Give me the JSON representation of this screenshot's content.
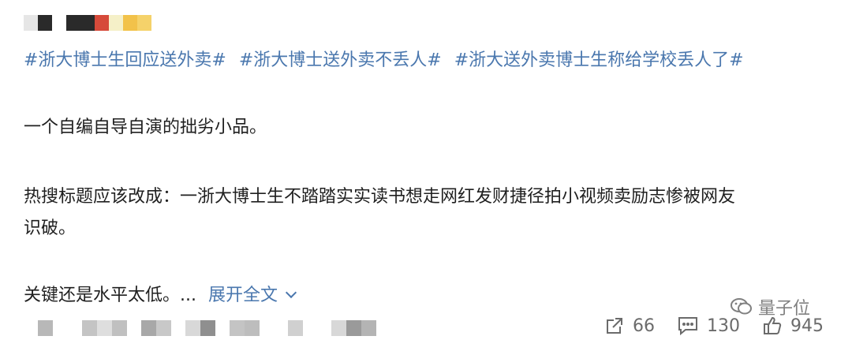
{
  "hashtags": [
    "#浙大博士生回应送外卖#",
    "#浙大博士送外卖不丢人#",
    "#浙大送外卖博士生称给学校丢人了#"
  ],
  "paragraphs": {
    "p1": "一个自编自导自演的拙劣小品。",
    "p2_line1": "热搜标题应该改成：一浙大博士生不踏踏实实读书想走网红发财捷径拍小视频卖励志惨被网友",
    "p2_line2": "识破。",
    "p3": "关键还是水平太低。..."
  },
  "expand_label": "展开全文",
  "actions": {
    "repost_count": "66",
    "comment_count": "130",
    "like_count": "945"
  },
  "watermark": "量子位",
  "colors": {
    "link": "#4a77ae",
    "text": "#1f1f1f",
    "muted": "#6b6b6b"
  },
  "icons": {
    "repost": "share-icon",
    "comment": "comment-icon",
    "like": "thumbs-up-icon",
    "watermark": "wechat-icon"
  }
}
